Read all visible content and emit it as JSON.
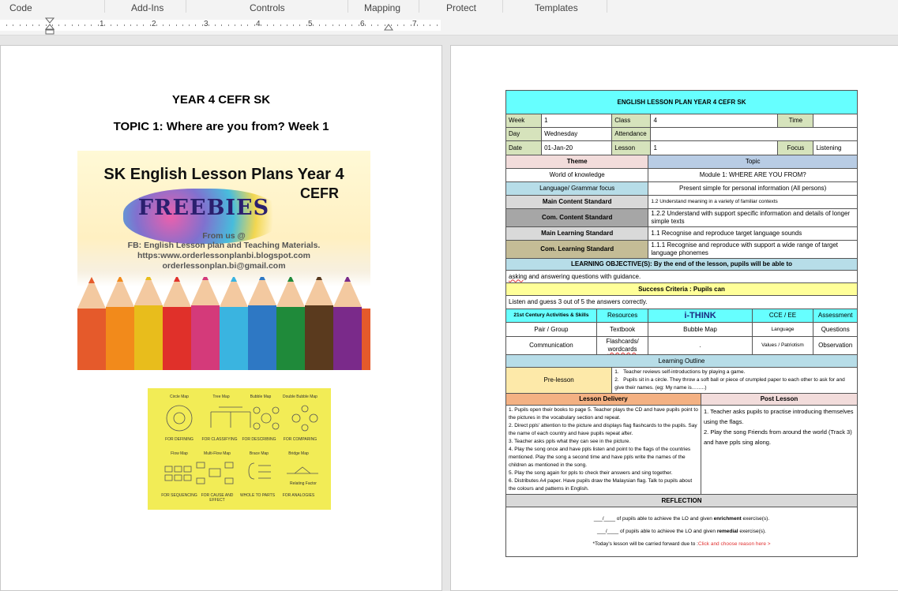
{
  "ribbon": {
    "tabs": [
      "Code",
      "Add-Ins",
      "Controls",
      "Mapping",
      "Protect",
      "Templates"
    ]
  },
  "ruler": {
    "numbers": [
      "1",
      "2",
      "3",
      "4",
      "5",
      "6",
      "7"
    ]
  },
  "page1": {
    "title": "YEAR 4 CEFR SK",
    "topic": "TOPIC 1: Where are you from?  Week 1",
    "cover": {
      "line1": "SK English Lesson Plans  Year 4",
      "line2": "CEFR",
      "freebies": "FREEBIES",
      "from": "From us @",
      "fb": "FB: English  Lesson  plan and Teaching Materials.",
      "url": "https:www.orderlessonplanbi.blogspot.com",
      "email": "orderlessonplan.bi@gmail.com"
    },
    "thinking_maps": {
      "row1": [
        "Circle Map",
        "Tree Map",
        "Bubble Map",
        "Double Bubble Map"
      ],
      "row1_uses": [
        "FOR DEFINING",
        "FOR CLASSIFYING",
        "FOR DESCRIBING",
        "FOR COMPARING"
      ],
      "row2": [
        "Flow Map",
        "Multi-Flow Map",
        "Brace Map",
        "Bridge Map"
      ],
      "row2_uses": [
        "FOR SEQUENCING",
        "FOR CAUSE AND EFFECT",
        "WHOLE TO PARTS",
        "FOR ANALOGIES"
      ],
      "extra": "Relating Factor"
    }
  },
  "lesson_plan": {
    "header": "ENGLISH LESSON PLAN YEAR 4 CEFR SK",
    "week_label": "Week",
    "week": "1",
    "class_label": "Class",
    "class": "4",
    "time_label": "Time",
    "time": "",
    "day_label": "Day",
    "day": "Wednesday",
    "attendance_label": "Attendance",
    "attendance": "",
    "date_label": "Date",
    "date": "01-Jan-20",
    "lesson_label": "Lesson",
    "lesson": "1",
    "focus_label": "Focus",
    "focus": "Listening",
    "theme_label": "Theme",
    "topic_label": "Topic",
    "theme": "World of  knowledge",
    "topic": "Module 1: WHERE ARE YOU FROM?",
    "grammar_label": "Language/ Grammar focus",
    "grammar": "Present simple for personal information (All persons)",
    "mcs_label": "Main Content Standard",
    "mcs": "1.2 Understand meaning in a variety of familiar contexts",
    "ccs_label": "Com. Content Standard",
    "ccs": "1.2.2 Understand with support specific information and details of longer simple texts",
    "mls_label": "Main Learning Standard",
    "mls": "1.1 Recognise and reproduce target language sounds",
    "cls_label": "Com. Learning Standard",
    "cls": "1.1.1 Recognise and reproduce with support a wide range of target language phonemes",
    "objective_label": "LEARNING OBJECTIVE(S):  By the end of the lesson, pupils will be able to",
    "objective_word": "asking",
    "objective": " and answering questions with guidance.",
    "success_label": "Success Criteria : Pupils can",
    "success": "Listen and guess 3 out of 5 the answers correctly.",
    "activities_label": "21st Century Activities & Skills",
    "resources_label": "Resources",
    "ithink_label": "i-THINK",
    "cce_label": "CCE / EE",
    "assessment_label": "Assessment",
    "pair_group": "Pair / Group",
    "communication": "Communication",
    "textbook": "Textbook",
    "flashcards": "Flashcards/",
    "wordcards": "wordcards",
    "bubble_map": "Bubble Map",
    "dot": ".",
    "language": "Language",
    "values": "Values / Patriotism",
    "questions": "Questions",
    "observation": "Observation",
    "outline_label": "Learning Outline",
    "prelesson_label": "Pre-lesson",
    "pre1": "Teacher reviews self-introductions by playing a game.",
    "pre2": "Pupils sit in a circle. They throw a soft ball or piece of crumpled paper to each other to ask for and give their names. (eg: My name is……..)",
    "delivery_label": "Lesson Delivery",
    "post_label": "Post Lesson",
    "delivery": [
      "1. Pupils open their books to page 5. Teacher plays the CD and have pupils point to the pictures in the vocabulary section and repeat.",
      "2. Direct ppls' attention to the picture and displays flag flashcards to the pupils. Say the name of each country and have pupils repeat after.",
      "3. Teacher asks ppls what they can see in the picture.",
      "4. Play the song once and have ppls listen and point to the flags of the countries mentioned. Play the song a second time and have ppls write the names of the children as mentioned in the song.",
      "5. Play the song again for ppls to check their answers and sing together.",
      "6. Distributes A4 paper. Have pupils draw the Malaysian flag. Talk to pupils about the colours and patterns in English."
    ],
    "post": [
      "1. Teacher asks pupils to practise introducing themselves using the flags.",
      "2. Play the song Friends from around the world (Track 3) and have ppls sing along."
    ],
    "reflection_label": "REFLECTION",
    "ref1_blank": "___/____",
    "ref1a": " of pupils able to achieve the LO and given ",
    "ref1b": "enrichment",
    "ref1c": " exercise(s).",
    "ref2_blank": "___/____",
    "ref2a": " of pupils able to achieve the LO and given ",
    "ref2b": "remedial",
    "ref2c": " exercise(s).",
    "ref3": "*Today's lesson will be carried forward due to :",
    "ref3_link": "Click and choose reason here >"
  }
}
